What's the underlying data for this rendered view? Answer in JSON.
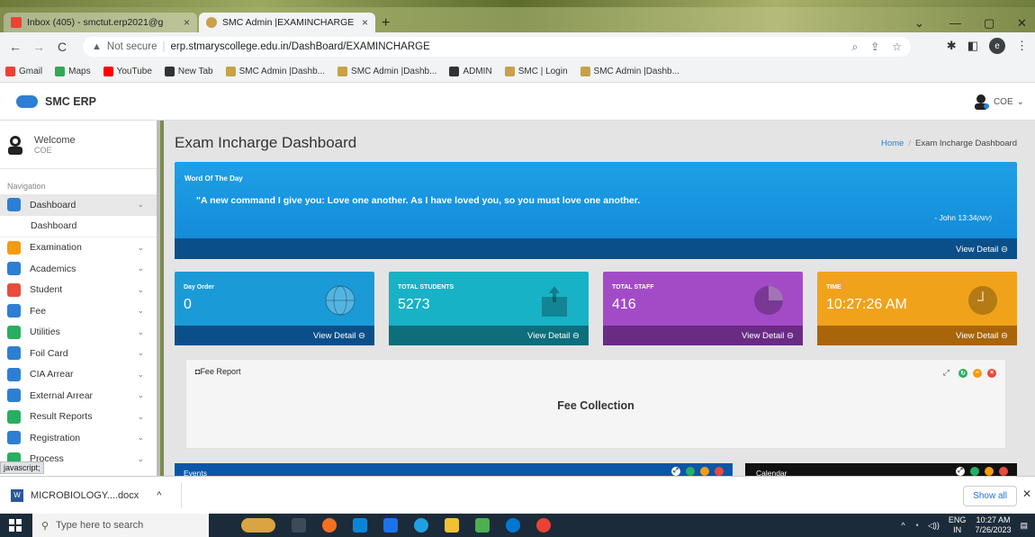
{
  "browser": {
    "tabs": [
      {
        "label": "Inbox (405) - smctut.erp2021@g"
      },
      {
        "label": "SMC Admin |EXAMINCHARGE"
      }
    ],
    "tab_close": "×",
    "new_tab": "+",
    "window_controls": [
      "⌄",
      "—",
      "▢",
      "✕"
    ],
    "not_secure": "Not secure",
    "url": "erp.stmaryscollege.edu.in/DashBoard/EXAMINCHARGE",
    "profile_initial": "e",
    "bookmarks": [
      {
        "label": "Gmail",
        "color": "#ea4335"
      },
      {
        "label": "Maps",
        "color": "#34a853"
      },
      {
        "label": "YouTube",
        "color": "#ff0000"
      },
      {
        "label": "New Tab",
        "color": "#333333"
      },
      {
        "label": "SMC Admin |Dashb...",
        "color": "#c9a14a"
      },
      {
        "label": "SMC Admin |Dashb...",
        "color": "#c9a14a"
      },
      {
        "label": "ADMIN",
        "color": "#333333"
      },
      {
        "label": "SMC | Login",
        "color": "#c9a14a"
      },
      {
        "label": "SMC Admin |Dashb...",
        "color": "#c9a14a"
      }
    ]
  },
  "app": {
    "brand": "SMC ERP",
    "user": "COE",
    "welcome_label": "Welcome",
    "welcome_user": "COE",
    "nav_header": "Navigation",
    "nav_items": [
      {
        "label": "Dashboard",
        "color": "#2d7fd3",
        "icon": "heartbeat-icon"
      },
      {
        "label": "Examination",
        "color": "#f39c12",
        "icon": "book-icon"
      },
      {
        "label": "Academics",
        "color": "#2d7fd3",
        "icon": "target-icon"
      },
      {
        "label": "Student",
        "color": "#e74c3c",
        "icon": "users-icon"
      },
      {
        "label": "Fee",
        "color": "#2d7fd3",
        "icon": "rupee-icon"
      },
      {
        "label": "Utilities",
        "color": "#27ae60",
        "icon": "window-icon"
      },
      {
        "label": "Foil Card",
        "color": "#2d7fd3",
        "icon": "edit-icon"
      },
      {
        "label": "CIA Arrear",
        "color": "#2d7fd3",
        "icon": "edit-icon"
      },
      {
        "label": "External Arrear",
        "color": "#2d7fd3",
        "icon": "edit-icon"
      },
      {
        "label": "Result Reports",
        "color": "#27ae60",
        "icon": "target-icon"
      },
      {
        "label": "Registration",
        "color": "#2d7fd3",
        "icon": "edit-icon"
      },
      {
        "label": "Process",
        "color": "#27ae60",
        "icon": "gear-icon"
      }
    ],
    "sub_item": "Dashboard",
    "status_url": "javascript;"
  },
  "page": {
    "title": "Exam Incharge Dashboard",
    "breadcrumb_home": "Home",
    "breadcrumb_current": "Exam Incharge Dashboard",
    "word_of_day": {
      "label": "Word Of The Day",
      "quote": "\"A new command I give you: Love one another. As I have loved you, so you must love one another.",
      "reference": "- John 13:34",
      "version": "(NIV)",
      "view_detail": "View Detail ⊖"
    },
    "cards": [
      {
        "label": "Day Order",
        "value": "0",
        "view": "View Detail ⊖",
        "color": "#1a9bd7",
        "foot": "#0b4f8a"
      },
      {
        "label": "TOTAL STUDENTS",
        "value": "5273",
        "view": "View Detail ⊖",
        "color": "#17b2c6",
        "foot": "#0d6e7c"
      },
      {
        "label": "TOTAL STAFF",
        "value": "416",
        "view": "View Detail ⊖",
        "color": "#a34bc7",
        "foot": "#6a2b85"
      },
      {
        "label": "TIME",
        "value": "10:27:26 AM",
        "view": "View Detail ⊖",
        "color": "#f0a31a",
        "foot": "#a8650a"
      }
    ],
    "fee_report": {
      "header": "Fee Report",
      "title": "Fee Collection"
    },
    "events_label": "Events",
    "calendar_label": "Calendar"
  },
  "downloads": {
    "file": "MICROBIOLOGY....docx",
    "show_all": "Show all"
  },
  "taskbar": {
    "search_placeholder": "Type here to search",
    "lang": "ENG",
    "region": "IN",
    "time": "10:27 AM",
    "date": "7/26/2023"
  }
}
